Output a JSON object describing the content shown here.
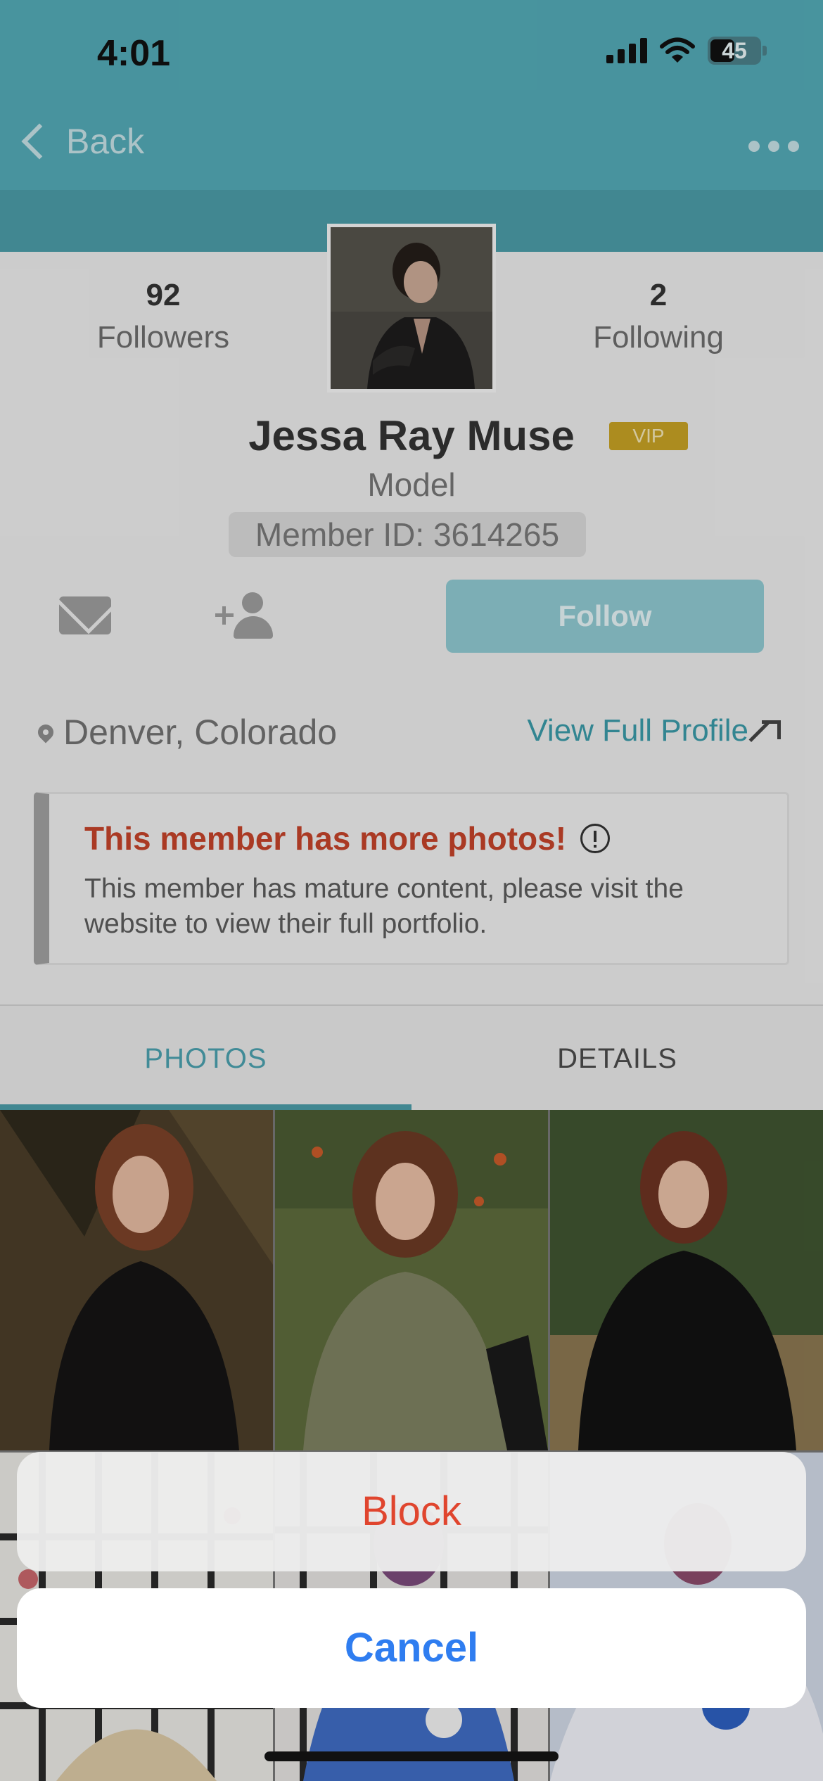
{
  "status_bar": {
    "time": "4:01",
    "battery": "45"
  },
  "nav": {
    "back_label": "Back"
  },
  "profile": {
    "followers_count": "92",
    "followers_label": "Followers",
    "following_count": "2",
    "following_label": "Following",
    "name": "Jessa Ray Muse",
    "badge": "VIP",
    "role": "Model",
    "member_id": "Member ID: 3614265",
    "follow_label": "Follow",
    "location": "Denver, Colorado",
    "view_full_profile": "View Full Profile"
  },
  "notice": {
    "title": "This member has more photos!",
    "body": "This member has mature content, please visit the website to view their full portfolio."
  },
  "tabs": {
    "photos": "PHOTOS",
    "details": "DETAILS"
  },
  "action_sheet": {
    "block_label": "Block",
    "cancel_label": "Cancel"
  },
  "colors": {
    "header": "#52a8b4",
    "accent": "#4a9aa5",
    "destructive": "#e0452e",
    "cancel": "#2f7df0",
    "badge": "#c4a024",
    "notice_title": "#c2422a"
  },
  "icons": [
    "back-chevron-icon",
    "more-icon",
    "signal-icon",
    "wifi-icon",
    "battery-icon",
    "mail-icon",
    "add-user-icon",
    "location-pin-icon",
    "external-arrow-icon",
    "info-icon"
  ]
}
